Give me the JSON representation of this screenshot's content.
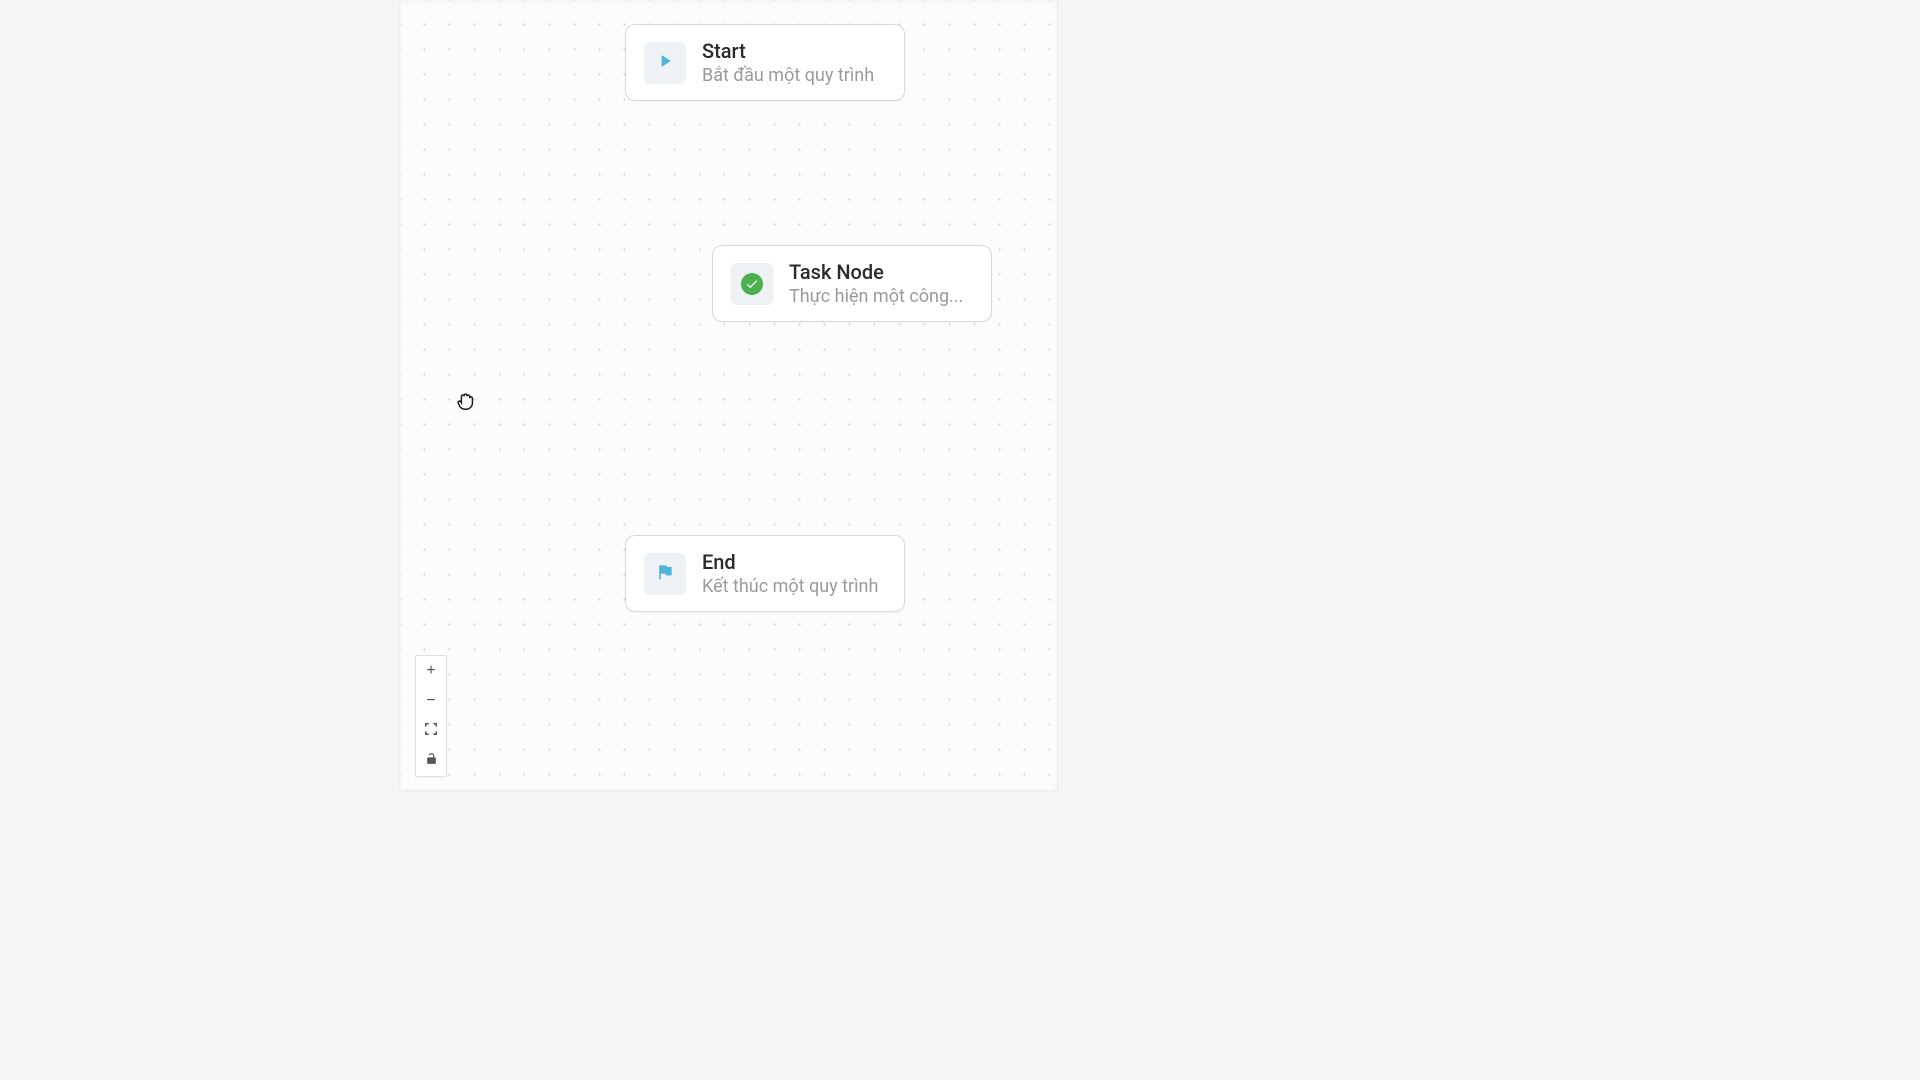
{
  "nodes": {
    "start": {
      "title": "Start",
      "subtitle": "Bắt đầu một quy trình"
    },
    "task": {
      "title": "Task Node",
      "subtitle": "Thực hiện một công..."
    },
    "end": {
      "title": "End",
      "subtitle": "Kết thúc một quy trình"
    }
  },
  "controls": {
    "zoom_in": "+",
    "zoom_out": "−"
  }
}
